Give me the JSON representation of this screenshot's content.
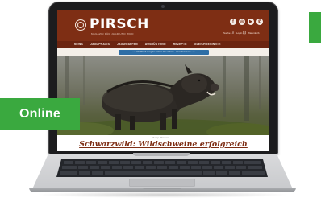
{
  "site": {
    "logo_text": "PIRSCH",
    "tagline": "MAGAZIN FÜR JAGD UND WILD",
    "utility": {
      "search": "Suche",
      "login": "Login",
      "cart": "Warenkorb"
    },
    "social_icons": [
      "facebook-icon",
      "instagram-icon",
      "youtube-icon",
      "whatsapp-icon"
    ],
    "nav_items": [
      "NEWS",
      "JAGDPRAXIS",
      "JAGDWAFFEN",
      "AUSRÜSTUNG",
      "REZEPTE",
      "GLEICHGESINNTE"
    ],
    "promo_text": "+++ Die Pirsch-Ausgabe jetzt im Abo sichern – hier informieren +++",
    "teaser_tag": "Top-Themen",
    "headline": "Schwarzwild: Wildschweine erfolgreich"
  },
  "badge": {
    "label": "Online"
  },
  "colors": {
    "header": "#7e2e14",
    "nav": "#6b2410",
    "promo": "#2f6ea6",
    "badge_green": "#3aa93f"
  }
}
